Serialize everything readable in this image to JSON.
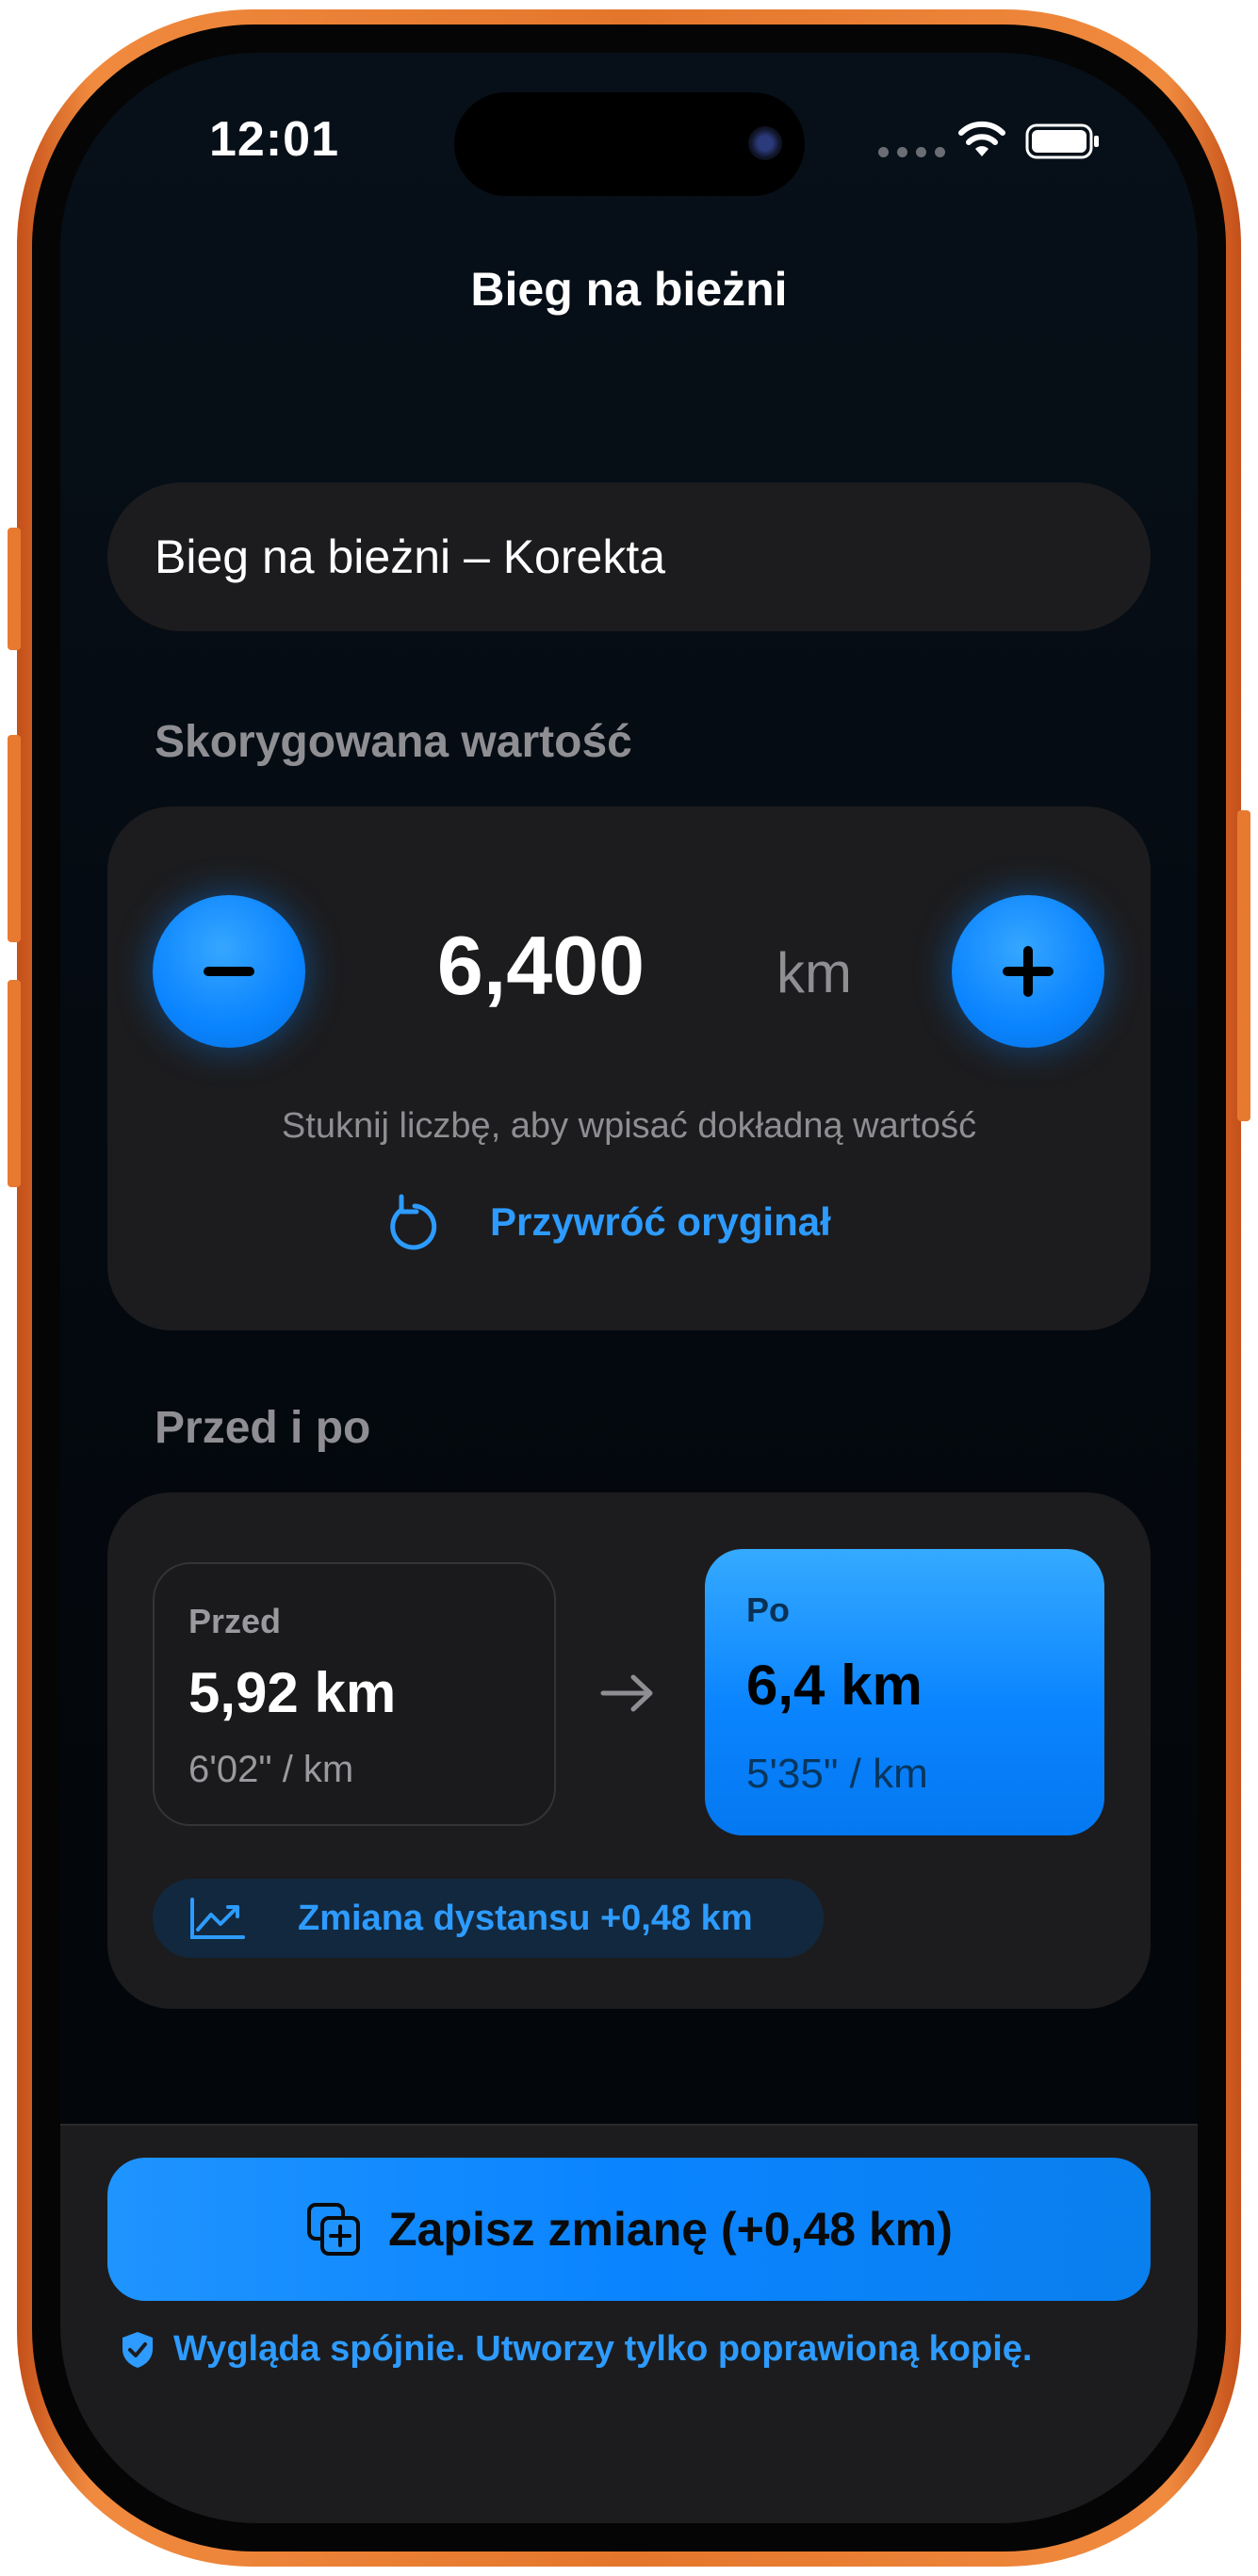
{
  "status_bar": {
    "time": "12:01"
  },
  "nav": {
    "title": "Bieg na bieżni"
  },
  "name_field": {
    "value": "Bieg na bieżni – Korekta"
  },
  "adjusted": {
    "section_label": "Skorygowana wartość",
    "value": "6,400",
    "unit": "km",
    "hint": "Stuknij liczbę, aby wpisać dokładną wartość",
    "restore_label": "Przywróć oryginał"
  },
  "comparison": {
    "section_label": "Przed i po",
    "before": {
      "label": "Przed",
      "distance": "5,92 km",
      "pace": "6'02\" / km"
    },
    "after": {
      "label": "Po",
      "distance": "6,4 km",
      "pace": "5'35\" / km"
    },
    "change_text": "Zmiana dystansu +0,48 km"
  },
  "footer": {
    "save_label": "Zapisz zmianę (+0,48 km)",
    "note": "Wygląda spójnie. Utworzy tylko poprawioną kopię."
  },
  "colors": {
    "accent": "#0a84ff",
    "frame": "#e4762c",
    "card": "#1c1c1e"
  }
}
